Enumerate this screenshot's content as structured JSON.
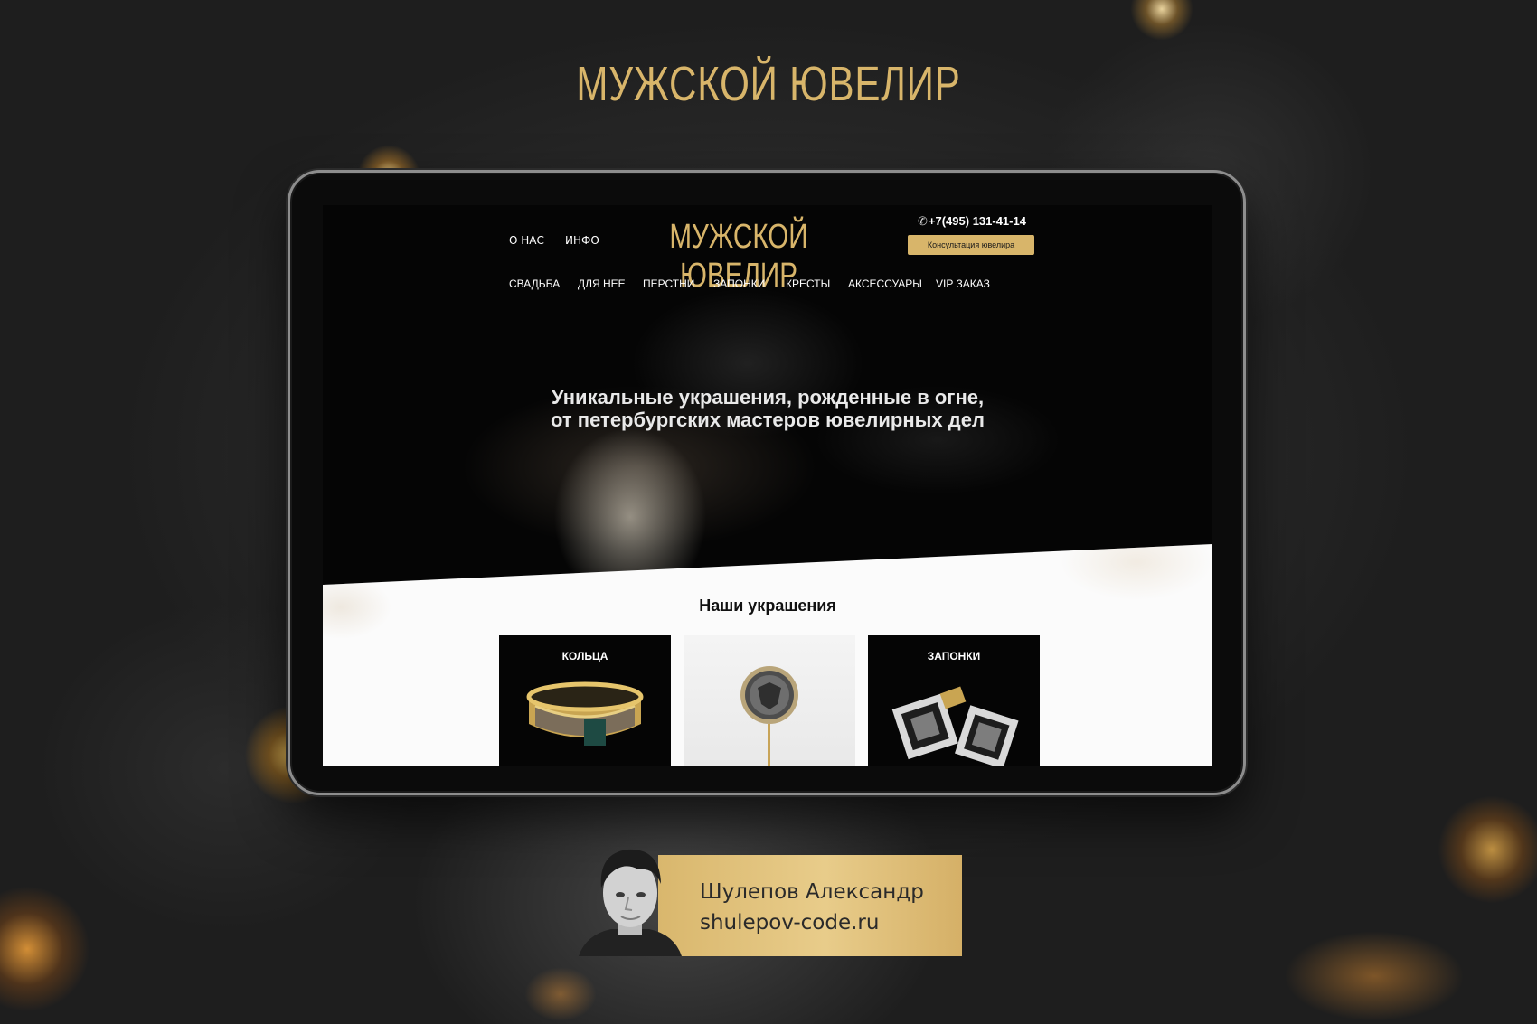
{
  "brand": {
    "logo_text": "МУЖСКОЙ ЮВЕЛИР"
  },
  "site": {
    "logo_text": "МУЖСКОЙ ЮВЕЛИР",
    "top_links": [
      "О НАС",
      "ИНФО"
    ],
    "phone": "+7(495) 131-41-14",
    "consult_button": "Консультация ювелира",
    "nav": [
      "СВАДЬБА",
      "ДЛЯ НЕЕ",
      "ПЕРСТНИ",
      "ЗАПОНКИ",
      "КРЕСТЫ",
      "АКСЕССУАРЫ",
      "VIP ЗАКАЗ"
    ],
    "hero": {
      "line1": "Уникальные украшения, рожденные в огне,",
      "line2": "от петербургских мастеров ювелирных дел"
    },
    "section_title": "Наши украшения",
    "cards": [
      {
        "label": "КОЛЬЦА"
      },
      {
        "label": ""
      },
      {
        "label": "ЗАПОНКИ"
      }
    ]
  },
  "author": {
    "name": "Шулепов Александр",
    "site": "shulepov-code.ru"
  },
  "colors": {
    "gold": "#d8b56a",
    "badge_gold": "#e2c47f",
    "page_bg": "#2a2a2a",
    "screen_bg": "#050505",
    "white_section": "#fbfbfb"
  },
  "icons": [
    "phone-icon",
    "ring-image",
    "coin-pin-image",
    "cufflinks-image",
    "author-portrait"
  ]
}
